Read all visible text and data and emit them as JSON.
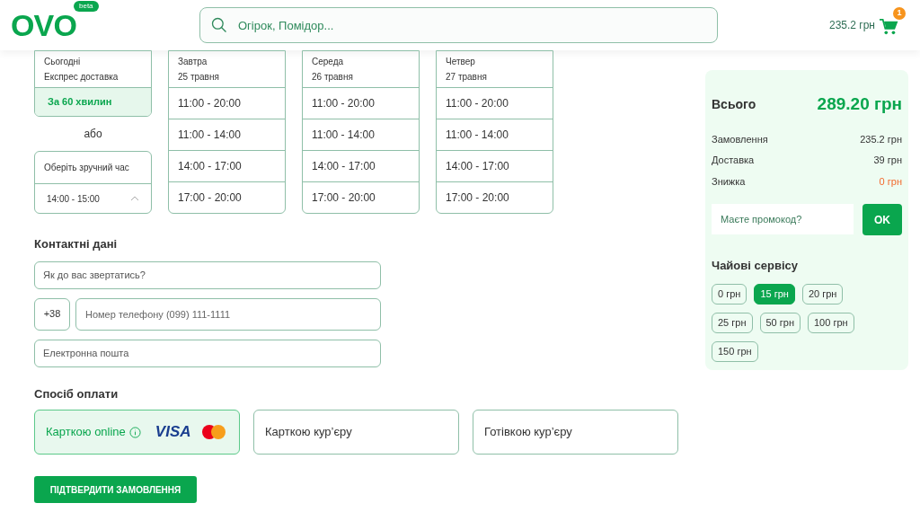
{
  "header": {
    "logo": "OVO",
    "badge": "beta",
    "search": {
      "placeholder": "Огірок, Помідор..."
    },
    "cart": {
      "total": "235.2 грн",
      "count": "1"
    }
  },
  "delivery": {
    "express": {
      "day": "Сьогодні",
      "label": "Експрес доставка",
      "option": {
        "label": "За 60 хвилин",
        "selected": true
      }
    },
    "separator": "або",
    "custom": {
      "label": "Оберіть зручний час",
      "value": "14:00 - 15:00",
      "expanded": false
    },
    "days": [
      {
        "day": "Завтра",
        "date": "25 травня",
        "slots": [
          {
            "label": "11:00 - 20:00",
            "selected": false
          },
          {
            "label": "11:00 - 14:00",
            "selected": false
          },
          {
            "label": "14:00 - 17:00",
            "selected": false
          },
          {
            "label": "17:00 - 20:00",
            "selected": false
          }
        ]
      },
      {
        "day": "Середа",
        "date": "26 травня",
        "slots": [
          {
            "label": "11:00 - 20:00",
            "selected": false
          },
          {
            "label": "11:00 - 14:00",
            "selected": false
          },
          {
            "label": "14:00 - 17:00",
            "selected": false
          },
          {
            "label": "17:00 - 20:00",
            "selected": false
          }
        ]
      },
      {
        "day": "Четвер",
        "date": "27 травня",
        "slots": [
          {
            "label": "11:00 - 20:00",
            "selected": false
          },
          {
            "label": "11:00 - 14:00",
            "selected": false
          },
          {
            "label": "14:00 - 17:00",
            "selected": false
          },
          {
            "label": "17:00 - 20:00",
            "selected": false
          }
        ]
      }
    ]
  },
  "contacts": {
    "title": "Контактні дані",
    "name": {
      "placeholder": "Як до вас звертатись?"
    },
    "phone_prefix": "+38",
    "phone": {
      "placeholder": "Номер телефону (099) 111-1111"
    },
    "email": {
      "placeholder": "Електронна пошта"
    }
  },
  "payment": {
    "title": "Спосіб оплати",
    "methods": [
      {
        "kind": "online",
        "label": "Карткою online",
        "brand": "VISA",
        "selected": true
      },
      {
        "kind": "plain",
        "label": "Карткою кур’єру",
        "selected": false
      },
      {
        "kind": "plain",
        "label": "Готівкою кур’єру",
        "selected": false
      }
    ]
  },
  "confirm_button": "ПІДТВЕРДИТИ ЗАМОВЛЕННЯ",
  "summary": {
    "total_label": "Всього",
    "total_value": "289.20 грн",
    "lines": [
      {
        "kind": "normal",
        "label": "Замовлення",
        "value": "235.2 грн"
      },
      {
        "kind": "normal",
        "label": "Доставка",
        "value": "39 грн"
      },
      {
        "kind": "discount",
        "label": "Знижка",
        "value": "0 грн"
      }
    ],
    "promo": {
      "placeholder": "Маєте промокод?"
    },
    "promo_button": "OK",
    "tips_title": "Чайові сервісу",
    "tips": [
      {
        "label": "0 грн",
        "selected": false
      },
      {
        "label": "15 грн",
        "selected": true
      },
      {
        "label": "20 грн",
        "selected": false
      },
      {
        "label": "25 грн",
        "selected": false
      },
      {
        "label": "50 грн",
        "selected": false
      },
      {
        "label": "100 грн",
        "selected": false
      },
      {
        "label": "150 грн",
        "selected": false
      }
    ]
  }
}
